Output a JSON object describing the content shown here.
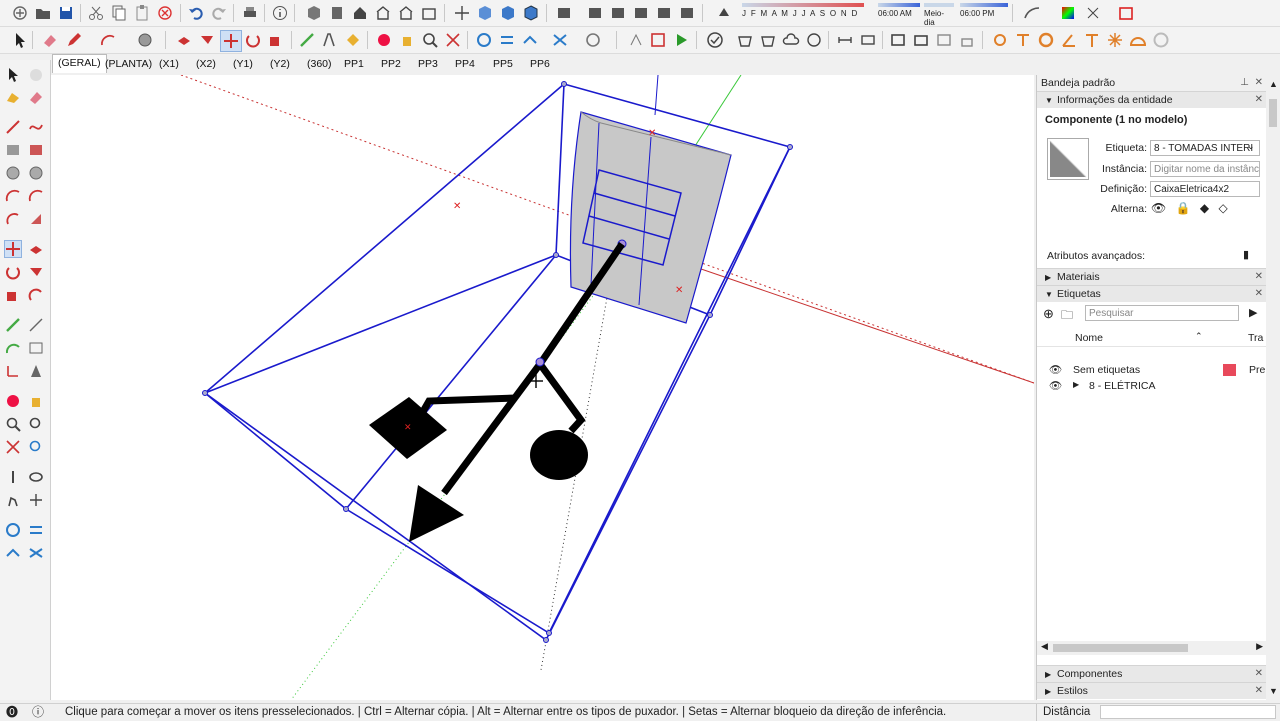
{
  "toolbar": {
    "months_label": "J F M A M J J A S O N D",
    "time_start": "06:00 AM",
    "time_mid": "Meio-dia",
    "time_end": "06:00 PM"
  },
  "scene_tabs": [
    "(GERAL)",
    "(PLANTA)",
    "(X1)",
    "(X2)",
    "(Y1)",
    "(Y2)",
    "(360)",
    "PP1",
    "PP2",
    "PP3",
    "PP4",
    "PP5",
    "PP6"
  ],
  "tray": {
    "title": "Bandeja padrão",
    "entity_info": {
      "section": "Informações da entidade",
      "heading": "Componente (1 no modelo)",
      "tag_label": "Etiqueta:",
      "tag_value": "8 - TOMADAS INTERI",
      "instance_label": "Instância:",
      "instance_placeholder": "Digitar nome da instância",
      "definition_label": "Definição:",
      "definition_value": "CaixaEletrica4x2",
      "toggle_label": "Alterna:",
      "advanced_label": "Atributos avançados:"
    },
    "materials": "Materiais",
    "tags": {
      "section": "Etiquetas",
      "search_placeholder": "Pesquisar",
      "col_name": "Nome",
      "col_dash": "Tra",
      "rows": [
        {
          "name": "Sem etiquetas",
          "dash": "Pre",
          "color": "#e8495b"
        },
        {
          "name": "8 - ELÉTRICA",
          "dash": "",
          "color": ""
        }
      ]
    },
    "components": "Componentes",
    "styles": "Estilos"
  },
  "status": {
    "message": "Clique para começar a mover os itens presselecionados. | Ctrl = Alternar cópia. | Alt = Alternar entre os tipos de puxador. | Setas = Alternar bloqueio da direção de inferência.",
    "measure_label": "Distância"
  },
  "colors": {
    "selection_blue": "#1a1acc",
    "axis_red": "#c83232",
    "axis_green": "#3ac83a"
  }
}
